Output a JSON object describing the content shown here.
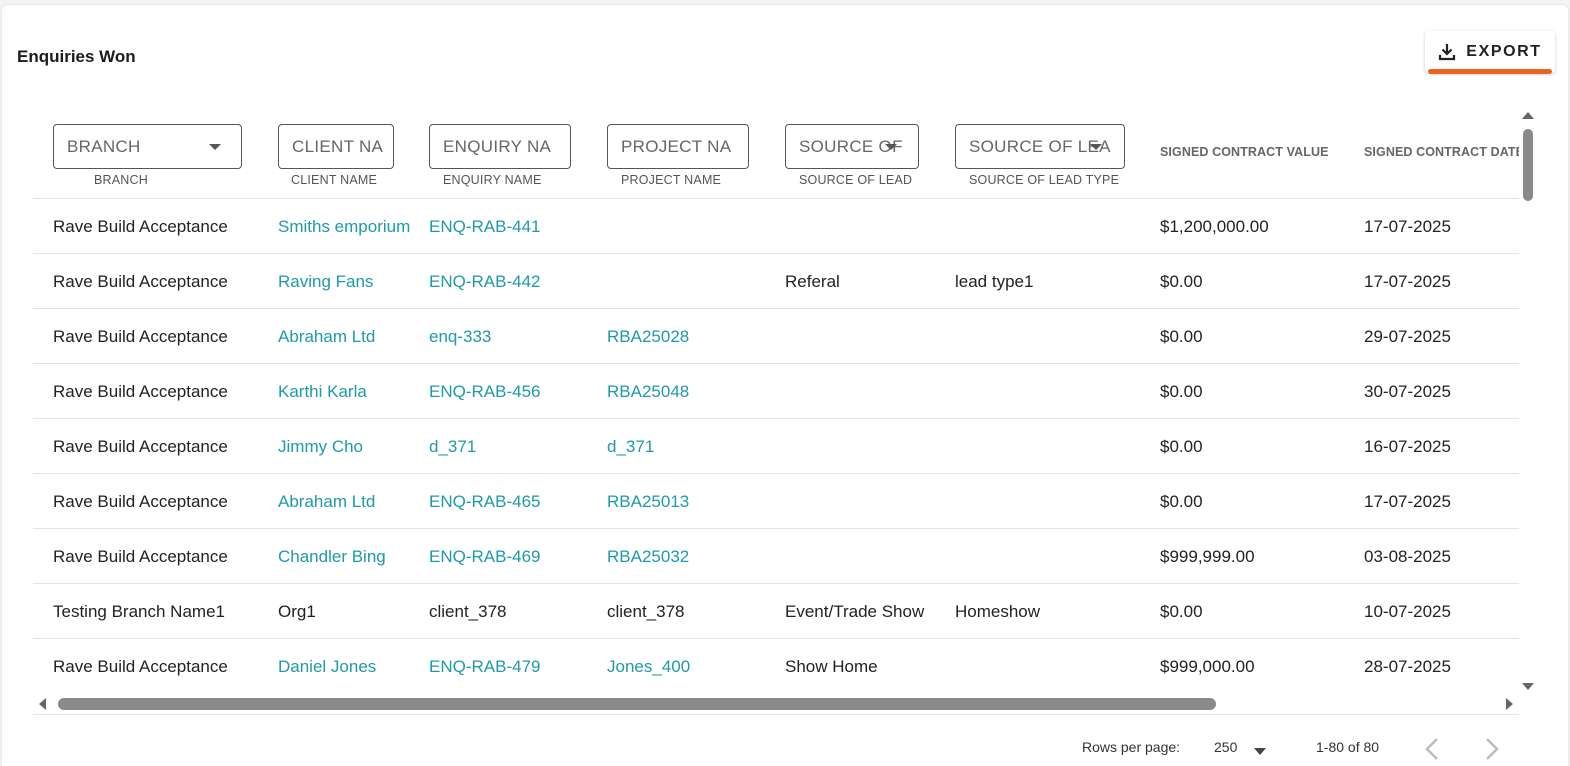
{
  "page": {
    "title": "Enquiries Won",
    "export_label": "EXPORT"
  },
  "columns": {
    "branch": {
      "placeholder": "BRANCH",
      "label": "BRANCH"
    },
    "client_name": {
      "placeholder": "CLIENT NA",
      "label": "CLIENT NAME"
    },
    "enquiry_name": {
      "placeholder": "ENQUIRY NA",
      "label": "ENQUIRY NAME"
    },
    "project_name": {
      "placeholder": "PROJECT NA",
      "label": "PROJECT NAME"
    },
    "source_of_lead": {
      "placeholder": "SOURCE OF",
      "label": "SOURCE OF LEAD"
    },
    "source_of_lead_type": {
      "placeholder": "SOURCE OF LEA",
      "label": "SOURCE OF LEAD TYPE"
    },
    "signed_contract_value": {
      "label": "SIGNED CONTRACT VALUE"
    },
    "signed_contract_date": {
      "label": "SIGNED CONTRACT DATE"
    }
  },
  "rows": [
    {
      "branch": "Rave Build Acceptance",
      "client": "Smiths emporium",
      "enquiry": "ENQ-RAB-441",
      "project": "",
      "source": "",
      "source_type": "",
      "value": "$1,200,000.00",
      "date": "17-07-2025"
    },
    {
      "branch": "Rave Build Acceptance",
      "client": "Raving Fans",
      "enquiry": "ENQ-RAB-442",
      "project": "",
      "source": "Referal",
      "source_type": "lead type1",
      "value": "$0.00",
      "date": "17-07-2025"
    },
    {
      "branch": "Rave Build Acceptance",
      "client": "Abraham Ltd",
      "enquiry": "enq-333",
      "project": "RBA25028",
      "source": "",
      "source_type": "",
      "value": "$0.00",
      "date": "29-07-2025"
    },
    {
      "branch": "Rave Build Acceptance",
      "client": "Karthi Karla",
      "enquiry": "ENQ-RAB-456",
      "project": "RBA25048",
      "source": "",
      "source_type": "",
      "value": "$0.00",
      "date": "30-07-2025"
    },
    {
      "branch": "Rave Build Acceptance",
      "client": "Jimmy Cho",
      "enquiry": "d_371",
      "project": "d_371",
      "source": "",
      "source_type": "",
      "value": "$0.00",
      "date": "16-07-2025"
    },
    {
      "branch": "Rave Build Acceptance",
      "client": "Abraham Ltd",
      "enquiry": "ENQ-RAB-465",
      "project": "RBA25013",
      "source": "",
      "source_type": "",
      "value": "$0.00",
      "date": "17-07-2025"
    },
    {
      "branch": "Rave Build Acceptance",
      "client": "Chandler Bing",
      "enquiry": "ENQ-RAB-469",
      "project": "RBA25032",
      "source": "",
      "source_type": "",
      "value": "$999,999.00",
      "date": "03-08-2025"
    },
    {
      "branch": "Testing Branch Name1",
      "client": "Org1",
      "enquiry": "client_378",
      "project": "client_378",
      "source": "Event/Trade Show",
      "source_type": "Homeshow",
      "value": "$0.00",
      "date": "10-07-2025"
    },
    {
      "branch": "Rave Build Acceptance",
      "client": "Daniel Jones",
      "enquiry": "ENQ-RAB-479",
      "project": "Jones_400",
      "source": "Show Home",
      "source_type": "",
      "value": "$999,000.00",
      "date": "28-07-2025"
    }
  ],
  "link_columns": {
    "row_0_to_6": [
      "client",
      "enquiry",
      "project"
    ],
    "row_7": [],
    "row_8": [
      "client",
      "enquiry",
      "project"
    ]
  },
  "pagination": {
    "rows_per_page_label": "Rows per page:",
    "rows_per_page_value": "250",
    "range": "1-80 of 80"
  },
  "colors": {
    "link": "#1e9aa8",
    "export_accent": "#f0601e"
  },
  "icons": [
    "download-icon",
    "dropdown-caret-icon",
    "chevron-left-icon",
    "chevron-right-icon"
  ]
}
